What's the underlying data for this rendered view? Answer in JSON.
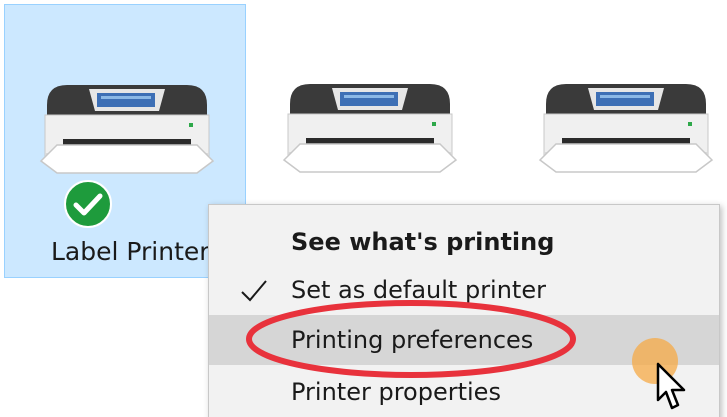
{
  "printers": [
    {
      "label": "Label Printer",
      "selected": true,
      "default": true
    },
    {
      "label": "",
      "selected": false,
      "default": false
    },
    {
      "label": "",
      "selected": false,
      "default": false
    }
  ],
  "context_menu": {
    "items": [
      {
        "label": "See what's printing",
        "bold": true,
        "checked": false,
        "hover": false
      },
      {
        "label": "Set as default printer",
        "bold": false,
        "checked": true,
        "hover": false
      },
      {
        "label": "Printing preferences",
        "bold": false,
        "checked": false,
        "hover": true
      },
      {
        "label": "Printer properties",
        "bold": false,
        "checked": false,
        "hover": false
      }
    ]
  },
  "colors": {
    "selection_bg": "#cce8ff",
    "selection_border": "#99d1ff",
    "menu_bg": "#f2f2f2",
    "menu_hover": "#d6d6d6",
    "default_badge": "#1e9b3c",
    "annotation_red": "#e8323c",
    "cursor_highlight": "#f5aa46"
  },
  "icons": {
    "printer": "printer-icon",
    "default_badge": "default-check-badge-icon",
    "check": "checkmark-icon",
    "cursor": "mouse-cursor-icon"
  }
}
